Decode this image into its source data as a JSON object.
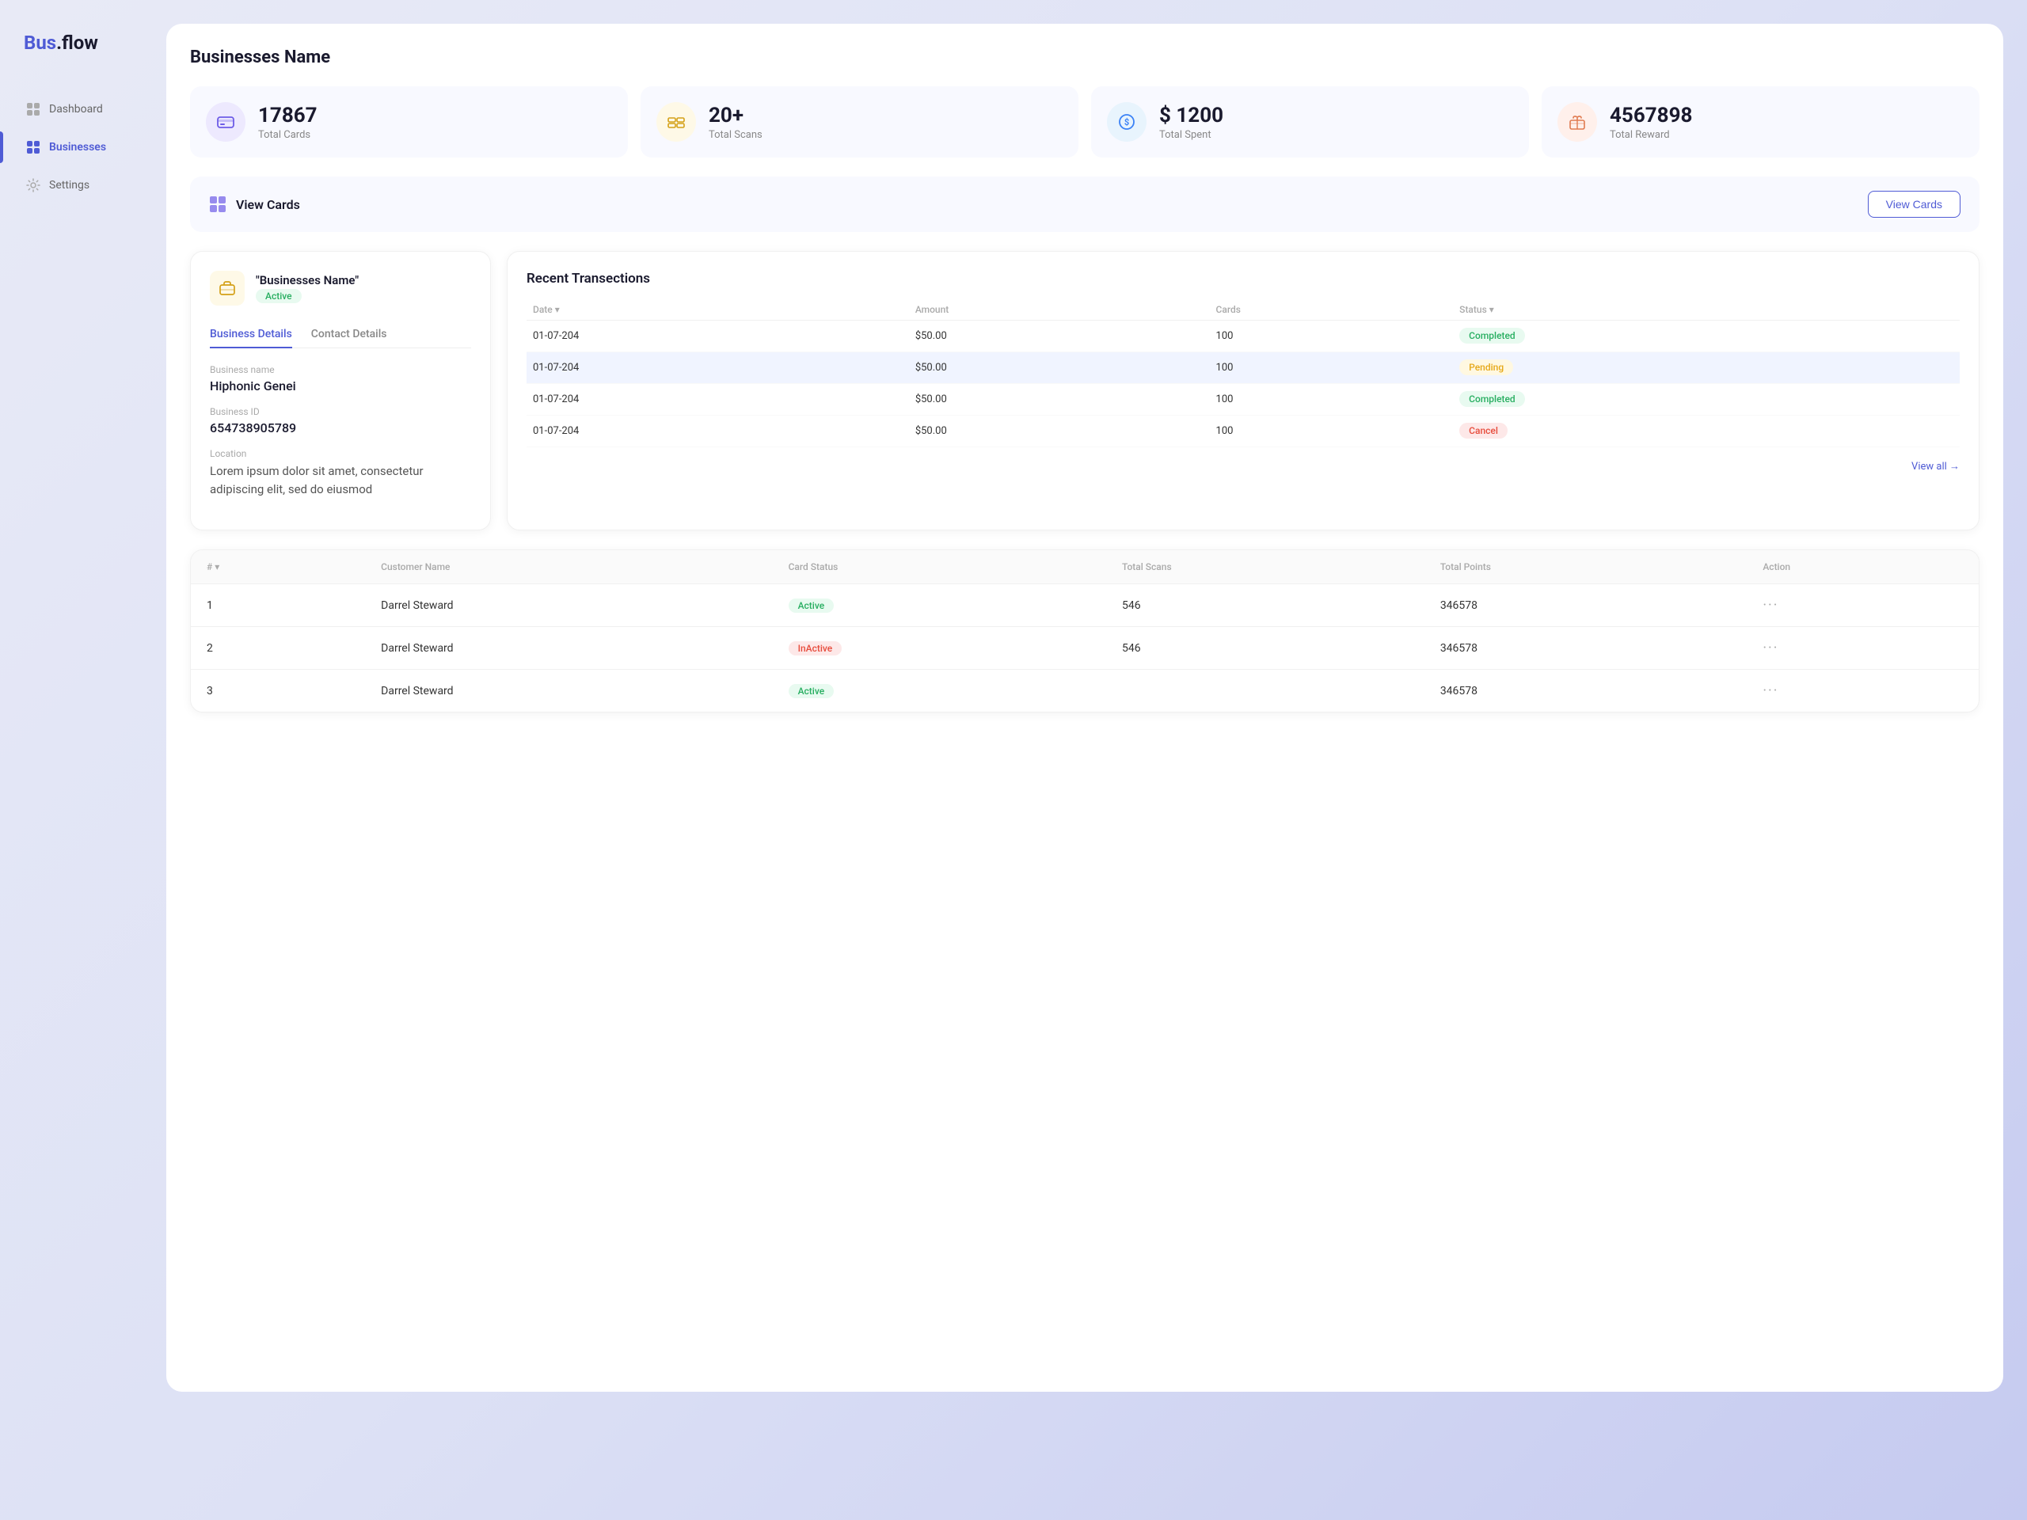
{
  "app": {
    "logo_bus": "Bus",
    "logo_flow": ".flow"
  },
  "sidebar": {
    "items": [
      {
        "id": "dashboard",
        "label": "Dashboard",
        "active": false
      },
      {
        "id": "businesses",
        "label": "Businesses",
        "active": true
      },
      {
        "id": "settings",
        "label": "Settings",
        "active": false
      }
    ]
  },
  "page": {
    "title": "Businesses Name"
  },
  "stats": [
    {
      "id": "total-cards",
      "value": "17867",
      "label": "Total Cards",
      "icon_type": "purple",
      "icon": "🎫"
    },
    {
      "id": "total-scans",
      "value": "20+",
      "label": "Total Scans",
      "icon_type": "yellow",
      "icon": "⊞"
    },
    {
      "id": "total-spent",
      "value": "$ 1200",
      "label": "Total Spent",
      "icon_type": "blue",
      "icon": "💲"
    },
    {
      "id": "total-reward",
      "value": "4567898",
      "label": "Total Reward",
      "icon_type": "orange",
      "icon": "🎁"
    }
  ],
  "view_cards_bar": {
    "label": "View Cards",
    "button_label": "View Cards"
  },
  "business": {
    "name": "\"Businesses Name\"",
    "status": "Active",
    "tabs": [
      {
        "id": "business-details",
        "label": "Business Details",
        "active": true
      },
      {
        "id": "contact-details",
        "label": "Contact Details",
        "active": false
      }
    ],
    "fields": [
      {
        "id": "business-name",
        "label": "Business name",
        "value": "Hiphonic Genei"
      },
      {
        "id": "business-id",
        "label": "Business ID",
        "value": "654738905789"
      },
      {
        "id": "location",
        "label": "Location",
        "value": "Lorem ipsum dolor sit amet, consectetur adipiscing elit, sed do eiusmod"
      }
    ]
  },
  "transactions": {
    "title": "Recent Transections",
    "columns": [
      {
        "id": "date",
        "label": "Date ▾"
      },
      {
        "id": "amount",
        "label": "Amount"
      },
      {
        "id": "cards",
        "label": "Cards"
      },
      {
        "id": "status",
        "label": "Status ▾"
      }
    ],
    "rows": [
      {
        "id": 1,
        "date": "01-07-204",
        "amount": "$50.00",
        "cards": "100",
        "status": "Completed",
        "status_type": "completed",
        "highlighted": false
      },
      {
        "id": 2,
        "date": "01-07-204",
        "amount": "$50.00",
        "cards": "100",
        "status": "Pending",
        "status_type": "pending",
        "highlighted": true
      },
      {
        "id": 3,
        "date": "01-07-204",
        "amount": "$50.00",
        "cards": "100",
        "status": "Completed",
        "status_type": "completed",
        "highlighted": false
      },
      {
        "id": 4,
        "date": "01-07-204",
        "amount": "$50.00",
        "cards": "100",
        "status": "Cancel",
        "status_type": "cancel",
        "highlighted": false
      }
    ],
    "view_all": "View all →"
  },
  "cards_table": {
    "columns": [
      {
        "id": "num",
        "label": "# ▾"
      },
      {
        "id": "customer-name",
        "label": "Customer Name"
      },
      {
        "id": "card-status",
        "label": "Card Status"
      },
      {
        "id": "total-scans",
        "label": "Total Scans"
      },
      {
        "id": "total-points",
        "label": "Total Points"
      },
      {
        "id": "action",
        "label": "Action"
      }
    ],
    "rows": [
      {
        "num": "1",
        "customer_name": "Darrel Steward",
        "card_status": "Active",
        "card_status_type": "active",
        "total_scans": "546",
        "total_points": "346578"
      },
      {
        "num": "2",
        "customer_name": "Darrel Steward",
        "card_status": "InActive",
        "card_status_type": "inactive",
        "total_scans": "546",
        "total_points": "346578"
      },
      {
        "num": "3",
        "customer_name": "Darrel Steward",
        "card_status": "Active",
        "card_status_type": "active",
        "total_scans": "",
        "total_points": "346578"
      }
    ]
  }
}
